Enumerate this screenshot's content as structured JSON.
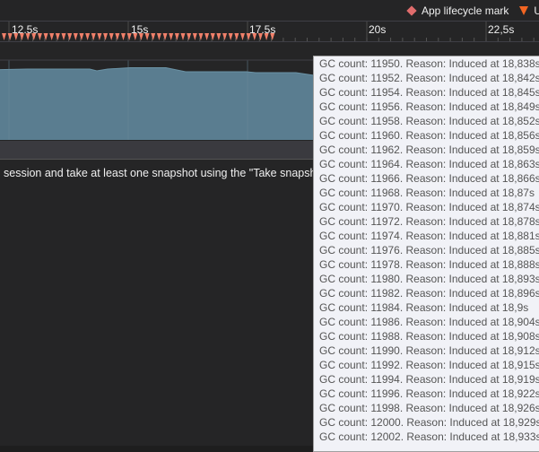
{
  "legend": {
    "items": [
      {
        "icon": "diamond-icon",
        "label": "App lifecycle mark",
        "color": "#e06c6c"
      },
      {
        "icon": "triangle-down-icon",
        "label": "Us",
        "color": "#f26522"
      }
    ]
  },
  "ruler": {
    "ticks": [
      "12.5s",
      "15s",
      "17.5s",
      "20s",
      "22,5s"
    ]
  },
  "colors": {
    "marker": "#f0806a",
    "area": "#5a7d90",
    "area_line": "#6b93a6"
  },
  "message": "session and take at least one snapshot using the \"Take snapsho",
  "tooltip": {
    "lines": [
      "GC count: 11950. Reason: Induced at 18,838s",
      "GC count: 11952. Reason: Induced at 18,842s",
      "GC count: 11954. Reason: Induced at 18,845s",
      "GC count: 11956. Reason: Induced at 18,849s",
      "GC count: 11958. Reason: Induced at 18,852s",
      "GC count: 11960. Reason: Induced at 18,856s",
      "GC count: 11962. Reason: Induced at 18,859s",
      "GC count: 11964. Reason: Induced at 18,863s",
      "GC count: 11966. Reason: Induced at 18,866s",
      "GC count: 11968. Reason: Induced at 18,87s",
      "GC count: 11970. Reason: Induced at 18,874s",
      "GC count: 11972. Reason: Induced at 18,878s",
      "GC count: 11974. Reason: Induced at 18,881s",
      "GC count: 11976. Reason: Induced at 18,885s",
      "GC count: 11978. Reason: Induced at 18,888s",
      "GC count: 11980. Reason: Induced at 18,893s",
      "GC count: 11982. Reason: Induced at 18,896s",
      "GC count: 11984. Reason: Induced at 18,9s",
      "GC count: 11986. Reason: Induced at 18,904s",
      "GC count: 11988. Reason: Induced at 18,908s",
      "GC count: 11990. Reason: Induced at 18,912s",
      "GC count: 11992. Reason: Induced at 18,915s",
      "GC count: 11994. Reason: Induced at 18,919s",
      "GC count: 11996. Reason: Induced at 18,922s",
      "GC count: 11998. Reason: Induced at 18,926s",
      "GC count: 12000. Reason: Induced at 18,929s",
      "GC count: 12002. Reason: Induced at 18,933s"
    ]
  }
}
